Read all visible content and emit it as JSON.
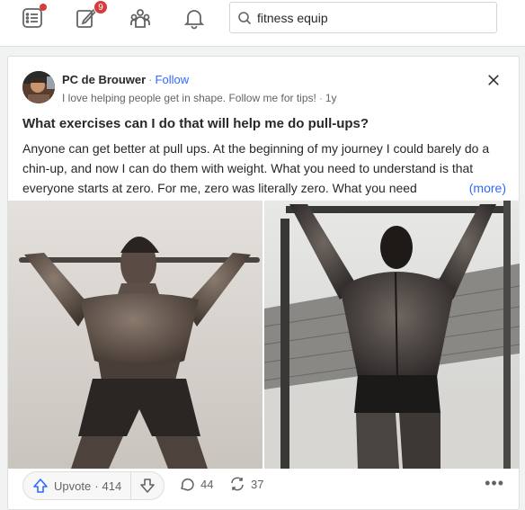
{
  "nav": {
    "icons": [
      "following-feed-icon",
      "answer-icon",
      "spaces-icon",
      "notifications-icon"
    ],
    "answer_badge": "9",
    "search": {
      "value": "fitness equip",
      "placeholder": "Search Quora"
    }
  },
  "post": {
    "author": "PC de Brouwer",
    "separator": "·",
    "follow_label": "Follow",
    "bio": "I love helping people get in shape. Follow me for tips!",
    "age": "1y",
    "question": "What exercises can I do that will help me do pull-ups?",
    "excerpt": "Anyone can get better at pull ups. At the beginning of my journey I could barely do a chin-up, and now I can do them with weight. What you need to understand is that everyone starts at zero. For me, zero was literally zero. What you need",
    "more_label": "(more)",
    "images": [
      "black-and-white photo of a shirtless man doing a chin-up on a bar",
      "black-and-white photo of a muscular man doing a pull-up, viewed from behind"
    ]
  },
  "actions": {
    "upvote_label": "Upvote",
    "upvote_sep": "·",
    "upvote_count": "414",
    "comments": "44",
    "shares": "37"
  },
  "colors": {
    "accent": "#2e69ff",
    "badge": "#d63c3c",
    "text": "#282829",
    "muted": "#636466"
  }
}
